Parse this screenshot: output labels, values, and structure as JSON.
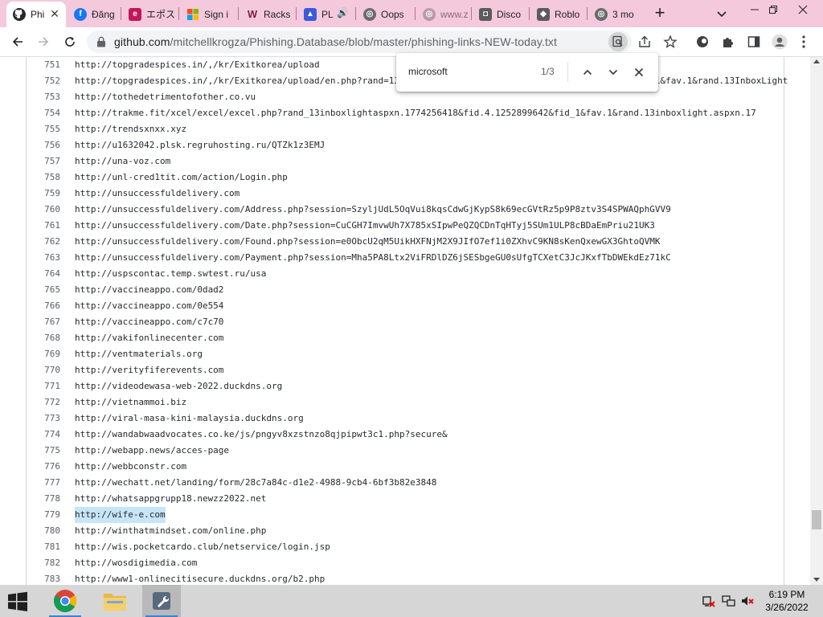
{
  "browser": {
    "tabs": [
      {
        "title": "Phi",
        "icon": "github-icon",
        "active": true
      },
      {
        "title": "Đăng",
        "icon": "facebook-icon"
      },
      {
        "title": "エポス",
        "icon": "epos-icon"
      },
      {
        "title": "Sign i",
        "icon": "microsoft-icon"
      },
      {
        "title": "Racks",
        "icon": "w-icon"
      },
      {
        "title": "PL",
        "icon": "game-icon"
      },
      {
        "title": "Oops",
        "icon": "globe-icon"
      },
      {
        "title": "www.z",
        "icon": "globe-icon"
      },
      {
        "title": "Disco",
        "icon": "discord-icon"
      },
      {
        "title": "Roblo",
        "icon": "roblox-icon"
      },
      {
        "title": "3 mo",
        "icon": "globe-icon"
      }
    ],
    "url_host": "github.com",
    "url_path": "/mitchellkrogza/Phishing.Database/blob/master/phishing-links-NEW-today.txt"
  },
  "find": {
    "query": "microsoft",
    "count": "1/3"
  },
  "file_lines": [
    {
      "n": "751",
      "text": "http://topgradespices.in/,/kr/Exitkorea/upload"
    },
    {
      "n": "752",
      "text": "http://topgradespices.in/,/kr/Exitkorea/upload/en.php?rand=13InboxLightaspxn.1774256418&fid.4.1252899642&fid_1&fav.1&rand.13InboxLight"
    },
    {
      "n": "753",
      "text": "http://tothedetrimentofother.co.vu"
    },
    {
      "n": "754",
      "text": "http://trakme.fit/xcel/excel/excel.php?rand_13inboxlightaspxn.1774256418&fid.4.1252899642&fid_1&fav.1&rand.13inboxlight.aspxn.17"
    },
    {
      "n": "755",
      "text": "http://trendsxnxx.xyz"
    },
    {
      "n": "756",
      "text": "http://u1632042.plsk.regruhosting.ru/QTZk1z3EMJ"
    },
    {
      "n": "757",
      "text": "http://una-voz.com"
    },
    {
      "n": "758",
      "text": "http://unl-cred1tit.com/action/Login.php"
    },
    {
      "n": "759",
      "text": "http://unsuccessfuldelivery.com"
    },
    {
      "n": "760",
      "text": "http://unsuccessfuldelivery.com/Address.php?session=SzyljUdL5OqVui8kqsCdwGjKypS8k69ecGVtRz5p9P8ztv3S4SPWAQphGVV9"
    },
    {
      "n": "761",
      "text": "http://unsuccessfuldelivery.com/Date.php?session=CuCGH7ImvwUh7X785xSIpwPeQZQCDnTqHTyj5SUm1ULP8cBDaEmPriu21UK3"
    },
    {
      "n": "762",
      "text": "http://unsuccessfuldelivery.com/Found.php?session=e0ObcU2qM5UikHXFNjM2X9JIfO7ef1i0ZXhvC9KN8sKenQxewGX3GhtoQVMK"
    },
    {
      "n": "763",
      "text": "http://unsuccessfuldelivery.com/Payment.php?session=Mha5PA8Ltx2ViFRDlDZ6jSESbgeGU0sUfgTCXetC3JcJKxfTbDWEkdEz71kC"
    },
    {
      "n": "764",
      "text": "http://uspscontac.temp.swtest.ru/usa"
    },
    {
      "n": "765",
      "text": "http://vaccineappo.com/0dad2"
    },
    {
      "n": "766",
      "text": "http://vaccineappo.com/0e554"
    },
    {
      "n": "767",
      "text": "http://vaccineappo.com/c7c70"
    },
    {
      "n": "768",
      "text": "http://vakifonlinecenter.com"
    },
    {
      "n": "769",
      "text": "http://ventmaterials.org"
    },
    {
      "n": "770",
      "text": "http://verityfiferevents.com"
    },
    {
      "n": "771",
      "text": "http://videodewasa-web-2022.duckdns.org"
    },
    {
      "n": "772",
      "text": "http://vietnammoi.biz"
    },
    {
      "n": "773",
      "text": "http://viral-masa-kini-malaysia.duckdns.org"
    },
    {
      "n": "774",
      "text": "http://wandabwaadvocates.co.ke/js/pngyv8xzstnzo8qjpipwt3c1.php?secure&"
    },
    {
      "n": "775",
      "text": "http://webapp.news/acces-page"
    },
    {
      "n": "776",
      "text": "http://webbconstr.com"
    },
    {
      "n": "777",
      "text": "http://wechatt.net/landing/form/28c7a84c-d1e2-4988-9cb4-6bf3b82e3848"
    },
    {
      "n": "778",
      "text": "http://whatsappgrupp18.newzz2022.net"
    },
    {
      "n": "779",
      "text": "http://wife-e.com",
      "selected": true
    },
    {
      "n": "780",
      "text": "http://winthatmindset.com/online.php"
    },
    {
      "n": "781",
      "text": "http://wis.pocketcardo.club/netservice/login.jsp"
    },
    {
      "n": "782",
      "text": "http://wosdigimedia.com"
    },
    {
      "n": "783",
      "text": "http://www1-onlinecitisecure.duckdns.org/b2.php"
    }
  ],
  "taskbar": {
    "apps": [
      {
        "name": "chrome",
        "icon": "chrome-icon"
      },
      {
        "name": "file-explorer",
        "icon": "folder-icon"
      },
      {
        "name": "settings-tool",
        "icon": "wrench-icon"
      }
    ],
    "time": "6:19 PM",
    "date": "3/26/2022"
  },
  "colors": {
    "tabstrip": "#f5c9dc",
    "selection": "#c6e6f7",
    "taskbar": "#d6d6d6"
  }
}
